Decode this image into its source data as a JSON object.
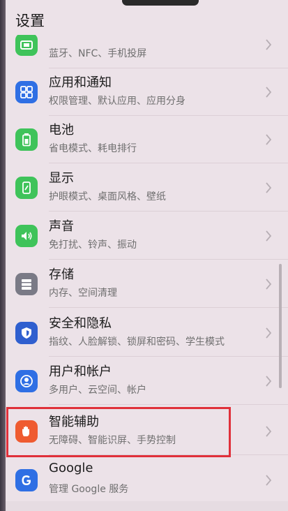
{
  "header": {
    "title": "设置"
  },
  "items": [
    {
      "label": "",
      "sub": "蓝牙、NFC、手机投屏",
      "icon": "device-connection-icon",
      "color": "#3fc35a"
    },
    {
      "label": "应用和通知",
      "sub": "权限管理、默认应用、应用分身",
      "icon": "apps-grid-icon",
      "color": "#2f6fe4"
    },
    {
      "label": "电池",
      "sub": "省电模式、耗电排行",
      "icon": "battery-icon",
      "color": "#3fc35a"
    },
    {
      "label": "显示",
      "sub": "护眼模式、桌面风格、壁纸",
      "icon": "display-phone-icon",
      "color": "#3fc35a"
    },
    {
      "label": "声音",
      "sub": "免打扰、铃声、振动",
      "icon": "speaker-icon",
      "color": "#3fc35a"
    },
    {
      "label": "存储",
      "sub": "内存、空间清理",
      "icon": "storage-icon",
      "color": "#7a7a86"
    },
    {
      "label": "安全和隐私",
      "sub": "指纹、人脸解锁、锁屏和密码、学生模式",
      "icon": "shield-icon",
      "color": "#2f5fcf"
    },
    {
      "label": "用户和帐户",
      "sub": "多用户、云空间、帐户",
      "icon": "user-icon",
      "color": "#2f6fe4"
    },
    {
      "label": "智能辅助",
      "sub": "无障碍、智能识屏、手势控制",
      "icon": "hand-icon",
      "color": "#ef5b30"
    },
    {
      "label": "Google",
      "sub": "管理 Google 服务",
      "icon": "google-icon",
      "color": "#2f6fe4"
    }
  ]
}
